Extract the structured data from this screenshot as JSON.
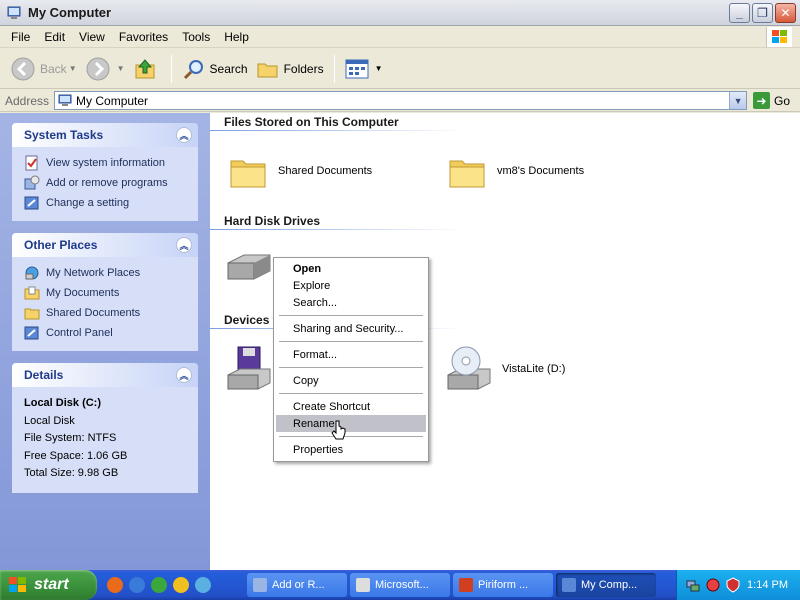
{
  "window": {
    "title": "My Computer",
    "buttons": {
      "minimize": "_",
      "maximize": "❐",
      "close": "✕"
    }
  },
  "menubar": [
    "File",
    "Edit",
    "View",
    "Favorites",
    "Tools",
    "Help"
  ],
  "toolbar": {
    "back": "Back",
    "search": "Search",
    "folders": "Folders"
  },
  "address": {
    "label": "Address",
    "value": "My Computer",
    "go": "Go"
  },
  "left": {
    "system_tasks": {
      "title": "System Tasks",
      "items": [
        "View system information",
        "Add or remove programs",
        "Change a setting"
      ]
    },
    "other_places": {
      "title": "Other Places",
      "items": [
        "My Network Places",
        "My Documents",
        "Shared Documents",
        "Control Panel"
      ]
    },
    "details": {
      "title": "Details",
      "name": "Local Disk (C:)",
      "type": "Local Disk",
      "filesystem": "File System: NTFS",
      "free": "Free Space: 1.06 GB",
      "total": "Total Size: 9.98 GB"
    }
  },
  "groups": {
    "files": {
      "title": "Files Stored on This Computer",
      "items": [
        "Shared Documents",
        "vm8's Documents"
      ]
    },
    "hdd": {
      "title": "Hard Disk Drives"
    },
    "removable": {
      "title": "Devices v",
      "items": [
        "VistaLite (D:)"
      ]
    }
  },
  "context_menu": {
    "open": "Open",
    "explore": "Explore",
    "search": "Search...",
    "sharing": "Sharing and Security...",
    "format": "Format...",
    "copy": "Copy",
    "create_shortcut": "Create Shortcut",
    "rename": "Rename",
    "properties": "Properties"
  },
  "taskbar": {
    "start": "start",
    "buttons": [
      "Add or R...",
      "Microsoft...",
      "Piriform ...",
      "My Comp..."
    ],
    "clock": "1:14 PM"
  },
  "colors": {
    "accent": "#215dc6",
    "taskbar": "#245edb",
    "start": "#3a8f3a",
    "highlight": "#c1c1c9"
  }
}
